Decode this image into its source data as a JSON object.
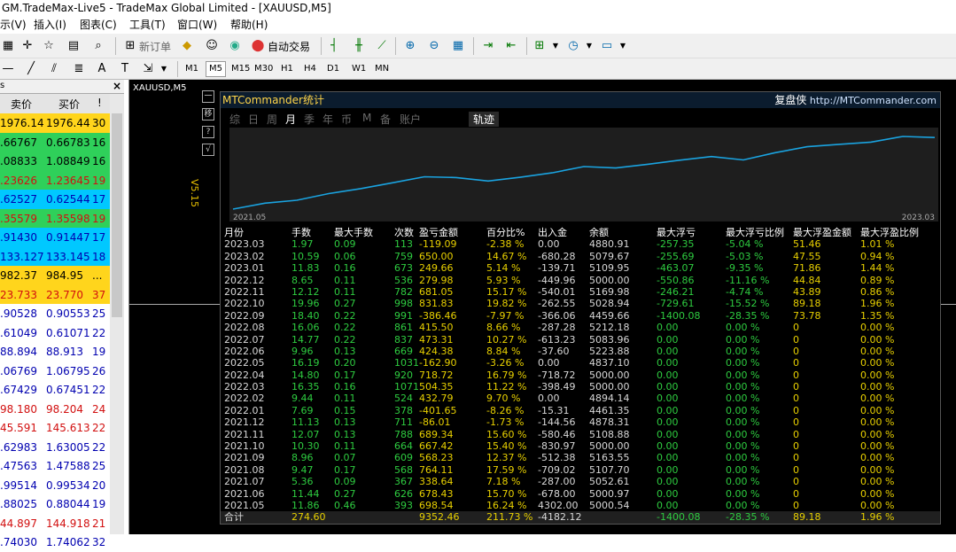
{
  "window_title": "GM.TradeMax-Live5 - TradeMax Global Limited - [XAUUSD,M5]",
  "menu": [
    "示(V)",
    "插入(I)",
    "图表(C)",
    "工具(T)",
    "窗口(W)",
    "帮助(H)"
  ],
  "toolbar": {
    "new_order": "新订单",
    "auto_trade": "自动交易"
  },
  "timeframes": [
    "M1",
    "M5",
    "M15",
    "M30",
    "H1",
    "H4",
    "D1",
    "W1",
    "MN"
  ],
  "active_timeframe": "M5",
  "market_watch": {
    "close": "×",
    "col_bid": "卖价",
    "col_ask": "买价",
    "col_spread": "!",
    "rows": [
      {
        "bid": "1976.14",
        "ask": "1976.44",
        "spread": "30",
        "bg": "#ffd51c",
        "fg": "#000"
      },
      {
        "bid": ".66767",
        "ask": "0.66783",
        "spread": "16",
        "bg": "#2fd05a",
        "fg": "#000"
      },
      {
        "bid": ".08833",
        "ask": "1.08849",
        "spread": "16",
        "bg": "#2fd05a",
        "fg": "#000"
      },
      {
        "bid": ".23626",
        "ask": "1.23645",
        "spread": "19",
        "bg": "#2fd05a",
        "fg": "#d21010"
      },
      {
        "bid": ".62527",
        "ask": "0.62544",
        "spread": "17",
        "bg": "#00c8ff",
        "fg": "#0000b0"
      },
      {
        "bid": ".35579",
        "ask": "1.35598",
        "spread": "19",
        "bg": "#2fd05a",
        "fg": "#d21010"
      },
      {
        "bid": ".91430",
        "ask": "0.91447",
        "spread": "17",
        "bg": "#00c8ff",
        "fg": "#0000b0"
      },
      {
        "bid": "133.127",
        "ask": "133.145",
        "spread": "18",
        "bg": "#00c8ff",
        "fg": "#0000b0"
      },
      {
        "bid": "982.37",
        "ask": "984.95",
        "spread": "...",
        "bg": "#ffd51c",
        "fg": "#000"
      },
      {
        "bid": "23.733",
        "ask": "23.770",
        "spread": "37",
        "bg": "#ffd51c",
        "fg": "#d21010"
      },
      {
        "bid": ".90528",
        "ask": "0.90553",
        "spread": "25",
        "bg": "#fff",
        "fg": "#0000b0"
      },
      {
        "bid": ".61049",
        "ask": "0.61071",
        "spread": "22",
        "bg": "#fff",
        "fg": "#0000b0"
      },
      {
        "bid": "88.894",
        "ask": "88.913",
        "spread": "19",
        "bg": "#fff",
        "fg": "#0000b0"
      },
      {
        "bid": ".06769",
        "ask": "1.06795",
        "spread": "26",
        "bg": "#fff",
        "fg": "#0000b0"
      },
      {
        "bid": ".67429",
        "ask": "0.67451",
        "spread": "22",
        "bg": "#fff",
        "fg": "#0000b0"
      },
      {
        "bid": "98.180",
        "ask": "98.204",
        "spread": "24",
        "bg": "#fff",
        "fg": "#d21010"
      },
      {
        "bid": "45.591",
        "ask": "145.613",
        "spread": "22",
        "bg": "#fff",
        "fg": "#d21010"
      },
      {
        "bid": ".62983",
        "ask": "1.63005",
        "spread": "22",
        "bg": "#fff",
        "fg": "#0000b0"
      },
      {
        "bid": ".47563",
        "ask": "1.47588",
        "spread": "25",
        "bg": "#fff",
        "fg": "#0000b0"
      },
      {
        "bid": ".99514",
        "ask": "0.99534",
        "spread": "20",
        "bg": "#fff",
        "fg": "#0000b0"
      },
      {
        "bid": ".88025",
        "ask": "0.88044",
        "spread": "19",
        "bg": "#fff",
        "fg": "#0000b0"
      },
      {
        "bid": "44.897",
        "ask": "144.918",
        "spread": "21",
        "bg": "#fff",
        "fg": "#d21010"
      },
      {
        "bid": ".74030",
        "ask": "1.74062",
        "spread": "32",
        "bg": "#fff",
        "fg": "#0000b0"
      }
    ]
  },
  "chart": {
    "symbol": "XAUUSD,M5"
  },
  "panel": {
    "title": "MTCommander统计",
    "brand_cn": "复盘侠",
    "brand_url": "http://MTCommander.com",
    "version": "V5.15",
    "side_buttons": [
      "一",
      "移",
      "?",
      "√"
    ],
    "tabs": [
      "综",
      "日",
      "周",
      "月",
      "季",
      "年",
      "币",
      "M",
      "备",
      "账户"
    ],
    "active_tab": "月",
    "track_label": "轨迹",
    "graph_from": "2021.05",
    "graph_to": "2023.03",
    "headers": [
      "月份",
      "手数",
      "最大手数",
      "次数",
      "盈亏金额",
      "百分比%",
      "出入金",
      "余额",
      "最大浮亏",
      "最大浮亏比例",
      "最大浮盈金额",
      "最大浮盈比例"
    ],
    "rows": [
      [
        "2023.03",
        "1.97",
        "0.09",
        "113",
        "-119.09",
        "-2.38 %",
        "0.00",
        "4880.91",
        "-257.35",
        "-5.04 %",
        "51.46",
        "1.01 %"
      ],
      [
        "2023.02",
        "10.59",
        "0.06",
        "759",
        "650.00",
        "14.67 %",
        "-680.28",
        "5079.67",
        "-255.69",
        "-5.03 %",
        "47.55",
        "0.94 %"
      ],
      [
        "2023.01",
        "11.83",
        "0.16",
        "673",
        "249.66",
        "5.14 %",
        "-139.71",
        "5109.95",
        "-463.07",
        "-9.35 %",
        "71.86",
        "1.44 %"
      ],
      [
        "2022.12",
        "8.65",
        "0.11",
        "536",
        "279.98",
        "5.93 %",
        "-449.96",
        "5000.00",
        "-550.86",
        "-11.16 %",
        "44.84",
        "0.89 %"
      ],
      [
        "2022.11",
        "12.12",
        "0.11",
        "782",
        "681.05",
        "15.17 %",
        "-540.01",
        "5169.98",
        "-246.21",
        "-4.74 %",
        "43.89",
        "0.86 %"
      ],
      [
        "2022.10",
        "19.96",
        "0.27",
        "998",
        "831.83",
        "19.82 %",
        "-262.55",
        "5028.94",
        "-729.61",
        "-15.52 %",
        "89.18",
        "1.96 %"
      ],
      [
        "2022.09",
        "18.40",
        "0.22",
        "991",
        "-386.46",
        "-7.97 %",
        "-366.06",
        "4459.66",
        "-1400.08",
        "-28.35 %",
        "73.78",
        "1.35 %"
      ],
      [
        "2022.08",
        "16.06",
        "0.22",
        "861",
        "415.50",
        "8.66 %",
        "-287.28",
        "5212.18",
        "0.00",
        "0.00 %",
        "0",
        "0.00 %"
      ],
      [
        "2022.07",
        "14.77",
        "0.22",
        "837",
        "473.31",
        "10.27 %",
        "-613.23",
        "5083.96",
        "0.00",
        "0.00 %",
        "0",
        "0.00 %"
      ],
      [
        "2022.06",
        "9.96",
        "0.13",
        "669",
        "424.38",
        "8.84 %",
        "-37.60",
        "5223.88",
        "0.00",
        "0.00 %",
        "0",
        "0.00 %"
      ],
      [
        "2022.05",
        "16.19",
        "0.20",
        "1031",
        "-162.90",
        "-3.26 %",
        "0.00",
        "4837.10",
        "0.00",
        "0.00 %",
        "0",
        "0.00 %"
      ],
      [
        "2022.04",
        "14.80",
        "0.17",
        "920",
        "718.72",
        "16.79 %",
        "-718.72",
        "5000.00",
        "0.00",
        "0.00 %",
        "0",
        "0.00 %"
      ],
      [
        "2022.03",
        "16.35",
        "0.16",
        "1071",
        "504.35",
        "11.22 %",
        "-398.49",
        "5000.00",
        "0.00",
        "0.00 %",
        "0",
        "0.00 %"
      ],
      [
        "2022.02",
        "9.44",
        "0.11",
        "524",
        "432.79",
        "9.70 %",
        "0.00",
        "4894.14",
        "0.00",
        "0.00 %",
        "0",
        "0.00 %"
      ],
      [
        "2022.01",
        "7.69",
        "0.15",
        "378",
        "-401.65",
        "-8.26 %",
        "-15.31",
        "4461.35",
        "0.00",
        "0.00 %",
        "0",
        "0.00 %"
      ],
      [
        "2021.12",
        "11.13",
        "0.13",
        "711",
        "-86.01",
        "-1.73 %",
        "-144.56",
        "4878.31",
        "0.00",
        "0.00 %",
        "0",
        "0.00 %"
      ],
      [
        "2021.11",
        "12.07",
        "0.13",
        "788",
        "689.34",
        "15.60 %",
        "-580.46",
        "5108.88",
        "0.00",
        "0.00 %",
        "0",
        "0.00 %"
      ],
      [
        "2021.10",
        "10.30",
        "0.11",
        "664",
        "667.42",
        "15.40 %",
        "-830.97",
        "5000.00",
        "0.00",
        "0.00 %",
        "0",
        "0.00 %"
      ],
      [
        "2021.09",
        "8.96",
        "0.07",
        "609",
        "568.23",
        "12.37 %",
        "-512.38",
        "5163.55",
        "0.00",
        "0.00 %",
        "0",
        "0.00 %"
      ],
      [
        "2021.08",
        "9.47",
        "0.17",
        "568",
        "764.11",
        "17.59 %",
        "-709.02",
        "5107.70",
        "0.00",
        "0.00 %",
        "0",
        "0.00 %"
      ],
      [
        "2021.07",
        "5.36",
        "0.09",
        "367",
        "338.64",
        "7.18 %",
        "-287.00",
        "5052.61",
        "0.00",
        "0.00 %",
        "0",
        "0.00 %"
      ],
      [
        "2021.06",
        "11.44",
        "0.27",
        "626",
        "678.43",
        "15.70 %",
        "-678.00",
        "5000.97",
        "0.00",
        "0.00 %",
        "0",
        "0.00 %"
      ],
      [
        "2021.05",
        "11.86",
        "0.46",
        "393",
        "698.54",
        "16.24 %",
        "4302.00",
        "5000.54",
        "0.00",
        "0.00 %",
        "0",
        "0.00 %"
      ]
    ],
    "total": [
      "合计",
      "274.60",
      "",
      "",
      "9352.46",
      "211.73 %",
      "-4182.12",
      "",
      "-1400.08",
      "-28.35 %",
      "89.18",
      "1.96 %"
    ]
  },
  "colors": {
    "panel_bg": "#000000",
    "header_text": "#ffffff",
    "green": "#2ecc40",
    "yellow": "#e8d000",
    "line": "#1aa3e0"
  }
}
